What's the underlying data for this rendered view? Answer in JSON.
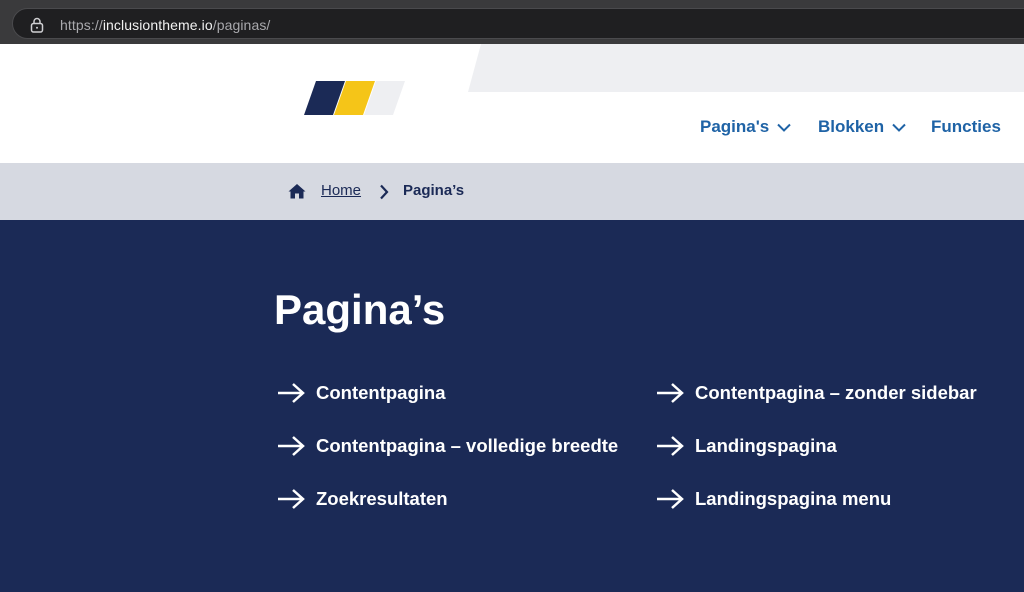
{
  "browser": {
    "url_host": "inclusiontheme.io",
    "url_prefix": "https://",
    "url_path": "/paginas/"
  },
  "logo": {
    "colors": [
      "#1b2a56",
      "#f5c518",
      "#eeeff2"
    ]
  },
  "nav": {
    "items": [
      {
        "label": "Pagina's",
        "has_dropdown": true
      },
      {
        "label": "Blokken",
        "has_dropdown": true
      },
      {
        "label": "Functies",
        "has_dropdown": false
      }
    ]
  },
  "breadcrumb": {
    "home_label": "Home",
    "current_label": "Pagina’s"
  },
  "main": {
    "title": "Pagina’s",
    "links": [
      {
        "label": "Contentpagina"
      },
      {
        "label": "Contentpagina – zonder sidebar"
      },
      {
        "label": "Contentpagina – volledige breedte"
      },
      {
        "label": "Landingspagina"
      },
      {
        "label": "Zoekresultaten"
      },
      {
        "label": "Landingspagina menu"
      }
    ]
  },
  "colors": {
    "navy": "#1b2a56",
    "link_blue": "#1f63a6",
    "breadcrumb_bg": "#d6d9e1",
    "yellow": "#f5c518"
  }
}
